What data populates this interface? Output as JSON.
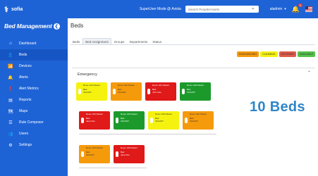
{
  "app": {
    "name": "sofia"
  },
  "topbar": {
    "mode_text": "SuperUser Mode @ Avista",
    "search_placeholder": "Search People/Assets",
    "user": "aladmin",
    "notif_count": "0"
  },
  "sidebar": {
    "title": "Bed Management",
    "items": [
      {
        "label": "Dashboard",
        "icon": "home-icon"
      },
      {
        "label": "Beds",
        "icon": "person-icon"
      },
      {
        "label": "Devices",
        "icon": "wifi-icon"
      },
      {
        "label": "Alerts",
        "icon": "bell-icon"
      },
      {
        "label": "Alert Metrics",
        "icon": "alert-circle-icon"
      },
      {
        "label": "Reports",
        "icon": "report-icon"
      },
      {
        "label": "Maps",
        "icon": "map-icon"
      },
      {
        "label": "Rule Composer",
        "icon": "rule-icon"
      },
      {
        "label": "Users",
        "icon": "users-icon"
      },
      {
        "label": "Settings",
        "icon": "gear-icon"
      }
    ]
  },
  "page": {
    "title": "Beds",
    "tabs": [
      "Beds",
      "Bed Assignment",
      "Groups",
      "Departments",
      "Status"
    ],
    "active_tab": "Bed Assignment"
  },
  "legend": [
    {
      "label": "DISCHARGING",
      "color": "#f59a0b"
    },
    {
      "label": "CLEANING",
      "color": "#f5f20f"
    },
    {
      "label": "ASSIGNED",
      "color": "#e05a4a"
    },
    {
      "label": "AVAILABLE",
      "color": "#55c24a"
    }
  ],
  "panel": {
    "title": "Emergency",
    "count_label": "10 Beds"
  },
  "cards": [
    {
      "title": "Room 104 Patient",
      "bed": "Bed",
      "status": "VACANT",
      "color": "yellow"
    },
    {
      "title": "Room 102 Patient",
      "bed": "Bed",
      "status": "VACANT",
      "color": "orange"
    },
    {
      "title": "Room 101 Patient",
      "bed": "Bed",
      "status": "John Doe",
      "color": "red"
    },
    {
      "title": "Room 108 Patient",
      "bed": "Bed",
      "status": "VACANT",
      "color": "green"
    },
    {
      "title": "Room 103 Patient",
      "bed": "Bed",
      "status": "Jane Doe",
      "color": "red"
    },
    {
      "title": "Room 106 Patient",
      "bed": "Bed",
      "status": "VACANT",
      "color": "green"
    },
    {
      "title": "Room 105 Patient",
      "bed": "Bed",
      "status": "VACANT",
      "color": "yellow"
    },
    {
      "title": "Room 102 Patient",
      "bed": "Bed",
      "status": "VACANT",
      "color": "orange"
    },
    {
      "title": "Room 103 Patient",
      "bed": "Bed",
      "status": "VACANT",
      "color": "orange"
    },
    {
      "title": "Room 109 Patient",
      "bed": "Bed",
      "status": "Jane Doe",
      "color": "red"
    }
  ]
}
